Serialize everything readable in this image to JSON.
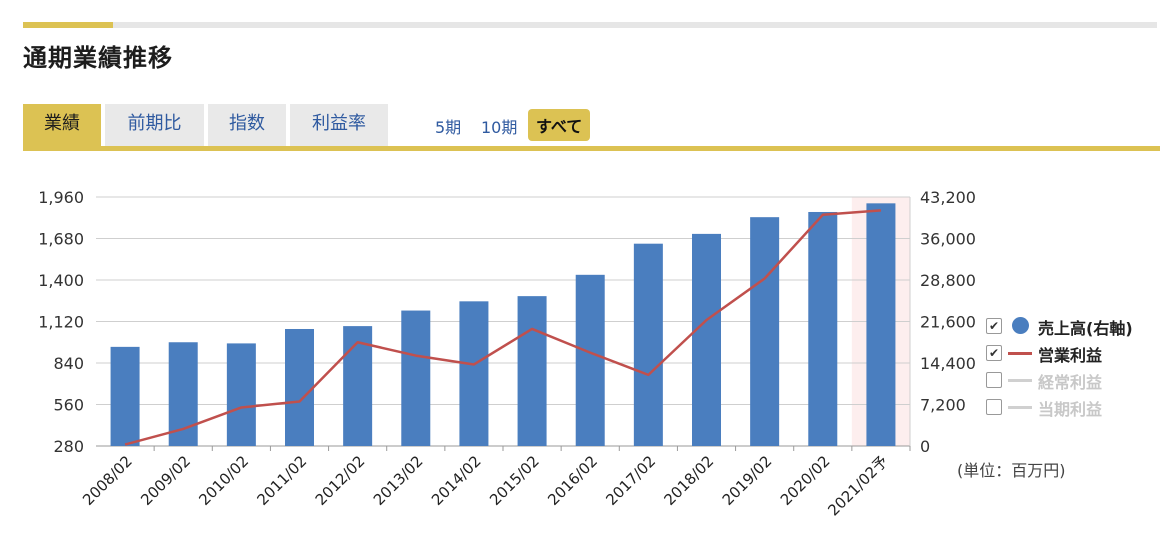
{
  "page": {
    "title": "通期業績推移"
  },
  "tabs": [
    {
      "label": "業績",
      "active": true
    },
    {
      "label": "前期比",
      "active": false
    },
    {
      "label": "指数",
      "active": false
    },
    {
      "label": "利益率",
      "active": false
    }
  ],
  "periods": [
    {
      "label": "5期",
      "active": false
    },
    {
      "label": "10期",
      "active": false
    },
    {
      "label": "すべて",
      "active": true
    }
  ],
  "legend": [
    {
      "label": "売上高(右軸)",
      "checked": true,
      "enabled": true,
      "kind": "dot"
    },
    {
      "label": "営業利益",
      "checked": true,
      "enabled": true,
      "kind": "line"
    },
    {
      "label": "経常利益",
      "checked": false,
      "enabled": false,
      "kind": "line"
    },
    {
      "label": "当期利益",
      "checked": false,
      "enabled": false,
      "kind": "line"
    }
  ],
  "unit_note": "(単位：百万円)",
  "colors": {
    "accent": "#dcc253",
    "bar": "#4a7ebf",
    "line": "#c0504d",
    "forecast_bg": "#fdeeee"
  },
  "chart_data": {
    "type": "bar",
    "categories": [
      "2008/02",
      "2009/02",
      "2010/02",
      "2011/02",
      "2012/02",
      "2013/02",
      "2014/02",
      "2015/02",
      "2016/02",
      "2017/02",
      "2018/02",
      "2019/02",
      "2020/02",
      "2021/02予"
    ],
    "series": [
      {
        "name": "売上高(右軸)",
        "type": "bar",
        "axis": "right",
        "values": [
          17200,
          18000,
          17800,
          20300,
          20800,
          23500,
          25100,
          26000,
          29700,
          35100,
          36800,
          39700,
          40600,
          42100
        ]
      },
      {
        "name": "営業利益",
        "type": "line",
        "axis": "left",
        "values": [
          290,
          395,
          540,
          580,
          980,
          890,
          830,
          1070,
          910,
          760,
          1130,
          1410,
          1840,
          1870
        ]
      }
    ],
    "left_axis": {
      "ylim": [
        280,
        1960
      ],
      "ticks": [
        "280",
        "560",
        "840",
        "1,120",
        "1,400",
        "1,680",
        "1,960"
      ]
    },
    "right_axis": {
      "ylim": [
        0,
        43200
      ],
      "ticks": [
        "0",
        "7,200",
        "14,400",
        "21,600",
        "28,800",
        "36,000",
        "43,200"
      ]
    },
    "forecast_index": 13,
    "grid": true,
    "legend_position": "right"
  }
}
